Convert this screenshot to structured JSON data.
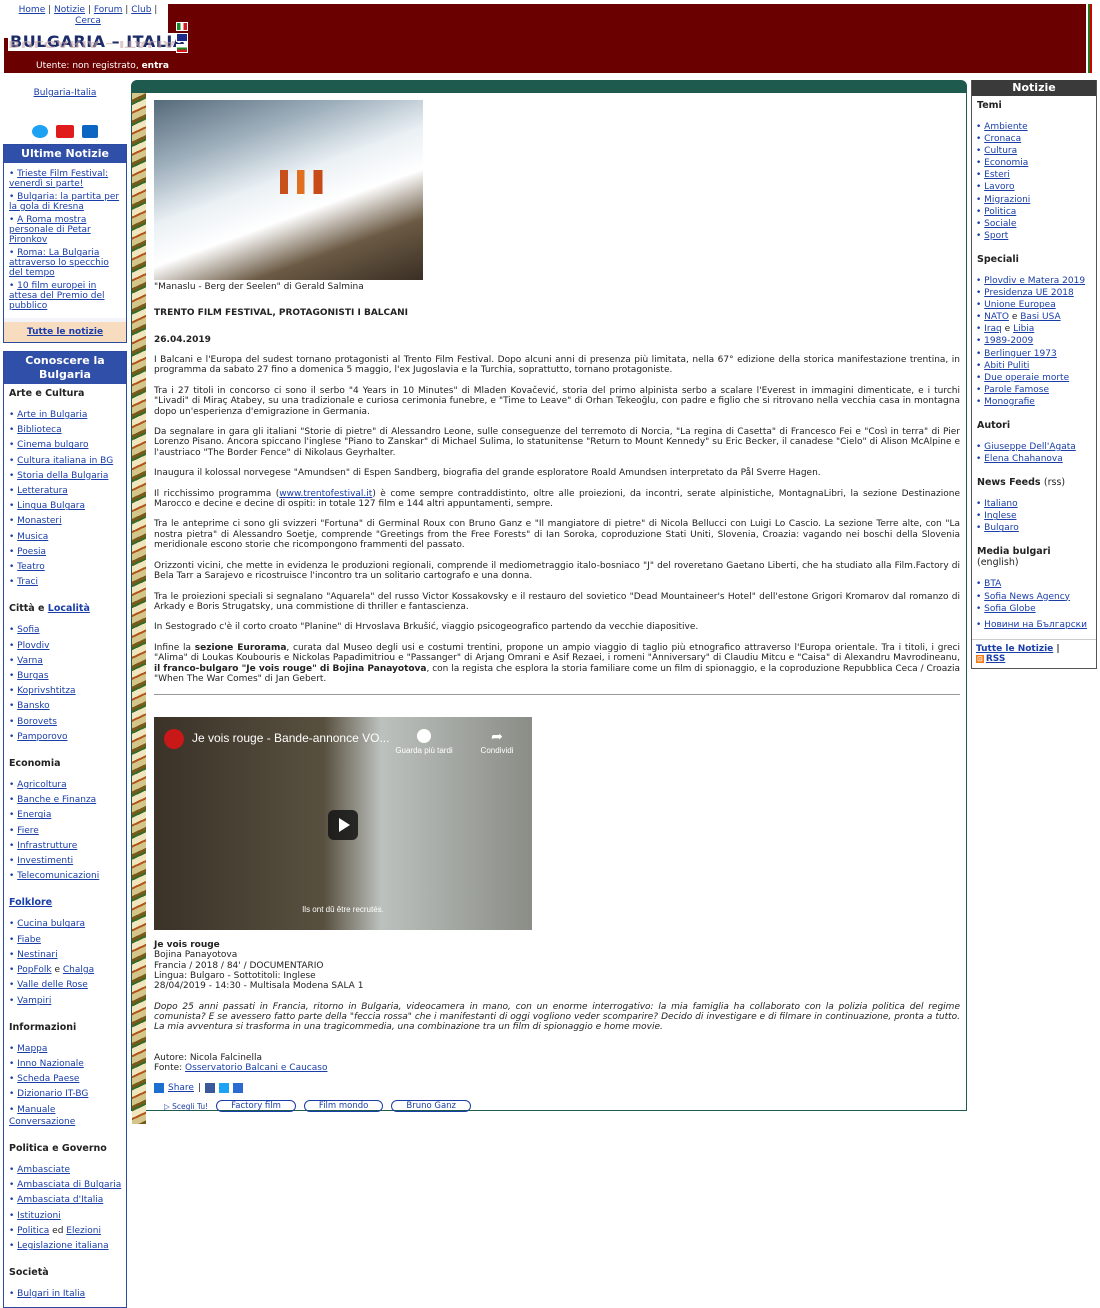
{
  "topnav": {
    "home": "Home",
    "notizie": "Notizie",
    "forum": "Forum",
    "club": "Club",
    "cerca": "Cerca"
  },
  "logo": {
    "text": "BULGARIA – ITALIA",
    "user_prefix": "Utente: non registrato,",
    "user_action": "entra"
  },
  "left": {
    "site_link": "Bulgaria-Italia",
    "social": [
      "twitter-icon",
      "youtube-icon",
      "linkedin-icon"
    ],
    "latest_title": "Ultime Notizie",
    "latest": [
      "Trieste Film Festival: venerdì si parte!",
      "Bulgaria: la partita per la gola di Kresna",
      "A Roma mostra personale di Petar Pironkov",
      "Roma: La Bulgaria attraverso lo specchio del tempo",
      "10 film europei in attesa del Premio del pubblico"
    ],
    "all_news": "Tutte le notizie",
    "know_title": "Conoscere la Bulgaria",
    "arte_title": "Arte e Cultura",
    "arte": [
      "Arte in Bulgaria",
      "Biblioteca",
      "Cinema bulgaro",
      "Cultura italiana in BG",
      "Storia della Bulgaria",
      "Letteratura",
      "Lingua Bulgara",
      "Monasteri",
      "Musica",
      "Poesia",
      "Teatro",
      "Traci"
    ],
    "citta_title_1": "Città e",
    "citta_title_2": "Località",
    "citta": [
      "Sofia",
      "Plovdiv",
      "Varna",
      "Burgas",
      "Koprivshtitza",
      "Bansko",
      "Borovets",
      "Pamporovo"
    ],
    "eco_title": "Economia",
    "eco": [
      "Agricoltura",
      "Banche e Finanza",
      "Energia",
      "Fiere",
      "Infrastrutture",
      "Investimenti",
      "Telecomunicazioni"
    ],
    "folk_title": "Folklore",
    "folk": [
      "Cucina bulgara",
      "Fiabe",
      "Nestinari"
    ],
    "folk_popfolk": "PopFolk",
    "folk_e": "e",
    "folk_chalga": "Chalga",
    "folk_rest": [
      "Valle delle Rose",
      "Vampiri"
    ],
    "info_title": "Informazioni",
    "info": [
      "Mappa",
      "Inno Nazionale",
      "Scheda Paese",
      "Dizionario IT-BG",
      "Manuale Conversazione"
    ],
    "pol_title": "Politica e Governo",
    "pol": [
      "Ambasciate",
      "Ambasciata di Bulgaria",
      "Ambasciata d'Italia",
      "Istituzioni"
    ],
    "pol_politica": "Politica",
    "pol_ed": "ed",
    "pol_elezioni": "Elezioni",
    "pol_last": "Legislazione italiana",
    "soc_title": "Società",
    "soc": [
      "Bulgari in Italia"
    ]
  },
  "article": {
    "caption": "\"Manaslu - Berg der Seelen\" di Gerald Salmina",
    "title": "TRENTO FILM FESTIVAL, PROTAGONISTI I BALCANI",
    "date": "26.04.2019",
    "p1": "I Balcani e l'Europa del sudest tornano protagonisti al Trento Film Festival. Dopo alcuni anni di presenza più limitata, nella 67° edizione della storica manifestazione trentina, in programma da sabato 27 fino a domenica 5 maggio, l'ex Jugoslavia e la Turchia, soprattutto, tornano protagoniste.",
    "p2": "Tra i 27 titoli in concorso ci sono il serbo \"4 Years in 10 Minutes\" di Mladen Kovačević, storia del primo alpinista serbo a scalare l'Everest in immagini dimenticate, e i turchi \"Livadi\" di Miraç Atabey, su una tradizionale e curiosa cerimonia funebre, e \"Time to Leave\" di Orhan Tekeoğlu, con padre e figlio che si ritrovano nella vecchia casa in montagna dopo un'esperienza d'emigrazione in Germania.",
    "p3": "Da segnalare in gara gli italiani \"Storie di pietre\" di Alessandro Leone, sulle conseguenze del terremoto di Norcia, \"La regina di Casetta\" di Francesco Fei e \"Così in terra\" di Pier Lorenzo Pisano. Ancora spiccano l'inglese \"Piano to Zanskar\" di Michael Sulima, lo statunitense \"Return to Mount Kennedy\" su Eric Becker, il canadese \"Cielo\" di Alison McAlpine e l'austriaco \"The Border Fence\" di Nikolaus Geyrhalter.",
    "p4": "Inaugura il kolossal norvegese \"Amundsen\" di Espen Sandberg, biografia del grande esploratore Roald Amundsen interpretato da Pål Sverre Hagen.",
    "p5_a": "Il ricchissimo programma (",
    "p5_link": "www.trentofestival.it",
    "p5_b": ") è come sempre contraddistinto, oltre alle proiezioni, da incontri, serate alpinistiche, MontagnaLibri, la sezione Destinazione Marocco e decine e decine di ospiti: in totale 127 film e 144 altri appuntamenti, sempre.",
    "p6": "Tra le anteprime ci sono gli svizzeri \"Fortuna\" di Germinal Roux con Bruno Ganz e \"Il mangiatore di pietre\" di Nicola Bellucci con Luigi Lo Cascio. La sezione Terre alte, con \"La nostra pietra\" di Alessandro Soetje, comprende \"Greetings from the Free Forests\" di Ian Soroka, coproduzione Stati Uniti, Slovenia, Croazia: vagando nei boschi della Slovenia meridionale escono storie che ricompongono frammenti del passato.",
    "p7": "Orizzonti vicini, che mette in evidenza le produzioni regionali, comprende il mediometraggio italo-bosniaco \"J\" del roveretano Gaetano Liberti, che ha studiato alla Film.Factory di Bela Tarr a Sarajevo e ricostruisce l'incontro tra un solitario cartografo e una donna.",
    "p8": "Tra le proiezioni speciali si segnalano \"Aquarela\" del russo Victor Kossakovsky e il restauro del sovietico \"Dead Mountaineer's Hotel\" dell'estone Grigori Kromarov dal romanzo di Arkady e Boris Strugatsky, una commistione di thriller e fantascienza.",
    "p9": "In Sestogrado c'è il corto croato \"Planine\" di Hrvoslava Brkušić, viaggio psicogeografico partendo da vecchie diapositive.",
    "p10_a": "Infine la ",
    "p10_b": "sezione Eurorama",
    "p10_c": ", curata dal Museo degli usi e costumi trentini, propone un ampio viaggio di taglio più etnografico attraverso l'Europa orientale. Tra i titoli, i greci \"Alima\" di Loukas Koubouris e Nickolas Papadimitriou e \"Passanger\" di Arjang Omrani e Asif Rezaei, i romeni \"Anniversary\" di Claudiu Mitcu e \"Caisa\" di Alexandru Mavrodineanu, ",
    "p10_d": "il franco-bulgaro \"Je vois rouge\" di Bojina Panayotova",
    "p10_e": ", con la regista che esplora la storia familiare come un film di spionaggio, e la coproduzione Repubblica Ceca / Croazia \"When The War Comes\" di Jan Gebert."
  },
  "video": {
    "title": "Je vois rouge - Bande-annonce VO...",
    "watch_later": "Guarda più tardi",
    "share": "Condividi",
    "subtitle": "Ils ont dû être recrutés."
  },
  "film": {
    "title": "Je vois rouge",
    "director": "Bojina Panayotova",
    "info": "Francia / 2018 / 84' / DOCUMENTARIO",
    "lang": "Lingua: Bulgaro - Sottotitoli: Inglese",
    "screening": "28/04/2019 - 14:30 - Multisala Modena SALA 1",
    "synopsis": "Dopo 25 anni passati in Francia, ritorno in Bulgaria, videocamera in mano, con un enorme interrogativo: la mia famiglia ha collaborato con la polizia politica del regime comunista? E se avessero fatto parte della \"feccia rossa\" che i manifestanti di oggi vogliono veder scomparire? Decido di investigare e di filmare in continuazione, pronta a tutto. La mia avventura si trasforma in una tragicommedia, una combinazione tra un film di spionaggio e home movie.",
    "author": "Autore: Nicola Falcinella",
    "source_prefix": "Fonte:",
    "source_link": "Osservatorio Balcani e Caucaso"
  },
  "share": {
    "label": "Share",
    "sep": "|"
  },
  "tags": {
    "choose": "▷ Scegli Tu!",
    "items": [
      "Factory film",
      "Film mondo",
      "Bruno Ganz"
    ]
  },
  "right": {
    "title": "Notizie",
    "temi_title": "Temi",
    "temi": [
      "Ambiente",
      "Cronaca",
      "Cultura",
      "Economia",
      "Esteri",
      "Lavoro",
      "Migrazioni",
      "Politica",
      "Sociale",
      "Sport"
    ],
    "speciali_title": "Speciali",
    "speciali": [
      "Plovdiv e Matera 2019",
      "Presidenza UE 2018",
      "Unione Europea"
    ],
    "nato": "NATO",
    "e": "e",
    "basi": "Basi USA",
    "iraq": "Iraq",
    "libia": "Libia",
    "speciali_rest": [
      "1989-2009",
      "Berlinguer 1973",
      "Abiti Puliti",
      "Due operaie morte",
      "Parole Famose",
      "Monografie"
    ],
    "autori_title": "Autori",
    "autori": [
      "Giuseppe Dell'Agata",
      "Elena Chahanova"
    ],
    "feeds_title": "News Feeds",
    "feeds_suffix": "(rss)",
    "feeds": [
      "Italiano",
      "Inglese",
      "Bulgaro"
    ],
    "media_title": "Media bulgari",
    "media_suffix": "(english)",
    "media": [
      "BTA",
      "Sofia News Agency",
      "Sofia Globe"
    ],
    "media_bg": "Новини на Български",
    "all_news": "Tutte le Notizie",
    "rss": "RSS"
  },
  "colors": {
    "banner": "#6b0000",
    "main_border": "#1f5a4e",
    "left_box": "#2f4fa8",
    "right_header": "#3a3a3a"
  }
}
